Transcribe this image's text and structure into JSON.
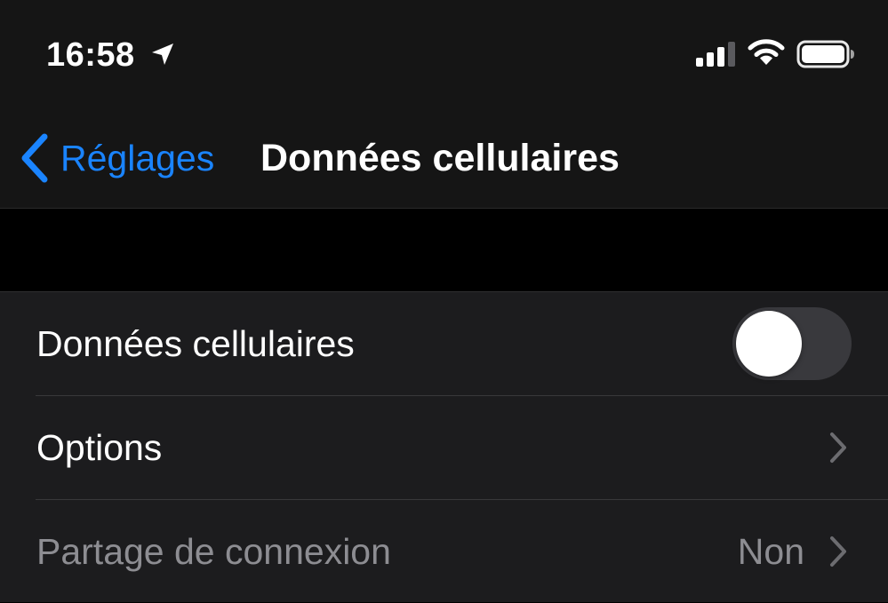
{
  "status_bar": {
    "time": "16:58",
    "icons": [
      "location-arrow-icon",
      "cellular-signal-icon",
      "wifi-icon",
      "battery-icon"
    ]
  },
  "nav": {
    "back_label": "Réglages",
    "title": "Données cellulaires"
  },
  "rows": [
    {
      "label": "Données cellulaires",
      "control": "toggle",
      "toggle_on": false
    },
    {
      "label": "Options",
      "control": "chevron"
    },
    {
      "label": "Partage de connexion",
      "control": "chevron",
      "value": "Non",
      "disabled": true
    }
  ],
  "colors": {
    "accent": "#1a84ff",
    "background": "#000000",
    "nav_background": "#151515",
    "group_background": "#1c1c1e",
    "secondary_text": "#8d8d92",
    "toggle_off": "#39393d"
  }
}
